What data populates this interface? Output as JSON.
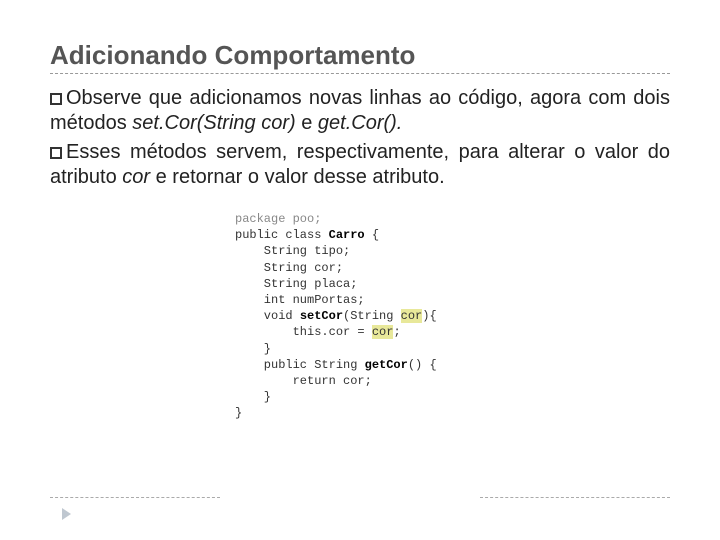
{
  "title": "Adicionando Comportamento",
  "paragraphs": {
    "p1_a": "Observe que adicionamos novas linhas ao código, agora com dois métodos ",
    "p1_b": "set.Cor(String cor)",
    "p1_c": " e ",
    "p1_d": "get.Cor().",
    "p2_a": "Esses métodos servem, respectivamente, para alterar o valor do atributo ",
    "p2_b": "cor",
    "p2_c": " e retornar o valor desse atributo."
  },
  "code": {
    "l01": "package poo;",
    "l02": "",
    "l03_a": "public class ",
    "l03_b": "Carro",
    "l03_c": " {",
    "l04": "",
    "l05": "    String tipo;",
    "l06": "    String cor;",
    "l07": "    String placa;",
    "l08": "    int numPortas;",
    "l09": "",
    "l10_a": "    void ",
    "l10_b": "setCor",
    "l10_c": "(String ",
    "l10_d": "cor",
    "l10_e": "){",
    "l11_a": "        this.cor = ",
    "l11_b": "cor",
    "l11_c": ";",
    "l12": "    }",
    "l13": "",
    "l14_a": "    public String ",
    "l14_b": "getCor",
    "l14_c": "() {",
    "l15": "        return cor;",
    "l16": "    }",
    "l17": "",
    "l18": "}"
  }
}
